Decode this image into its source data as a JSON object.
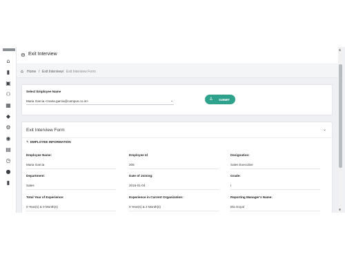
{
  "header": {
    "title": "Exit Interview"
  },
  "breadcrumb": {
    "home": "Home",
    "sep1": "/",
    "exit": "Exit Interview",
    "sep2": "/",
    "current": "Exit Interview Form"
  },
  "select_card": {
    "label": "Select Employee Name",
    "value": "Maria Garcia <maria.garcia@campus.co.in>",
    "submit_label": "SUBMIT"
  },
  "form": {
    "title": "Exit Interview Form",
    "section": "EMPLOYEE INFORMATION",
    "fields": [
      {
        "label": "Employee Name:",
        "value": "Maria Garcia"
      },
      {
        "label": "Employee Id",
        "value": "205"
      },
      {
        "label": "Designation:",
        "value": "Sales Executive"
      },
      {
        "label": "Department:",
        "value": "Sales"
      },
      {
        "label": "Date of Joining:",
        "value": "2016-01-04"
      },
      {
        "label": "Grade:",
        "value": "I"
      },
      {
        "label": "Total Year of Experience:",
        "value": "0 Year(s) & 0 Month(s)"
      },
      {
        "label": "Experience in Current Organization:",
        "value": "0 Year(s) & 2 Month(s)"
      },
      {
        "label": "Reporting Manager's Name:",
        "value": "Ela Goyal"
      }
    ]
  },
  "icons": {
    "back": "back-arrow-icon",
    "home": "home-icon",
    "pin": "wrench-icon",
    "chevron": "chevron-down-icon"
  },
  "colors": {
    "accent": "#2fa28d",
    "background": "#eef0f3"
  }
}
